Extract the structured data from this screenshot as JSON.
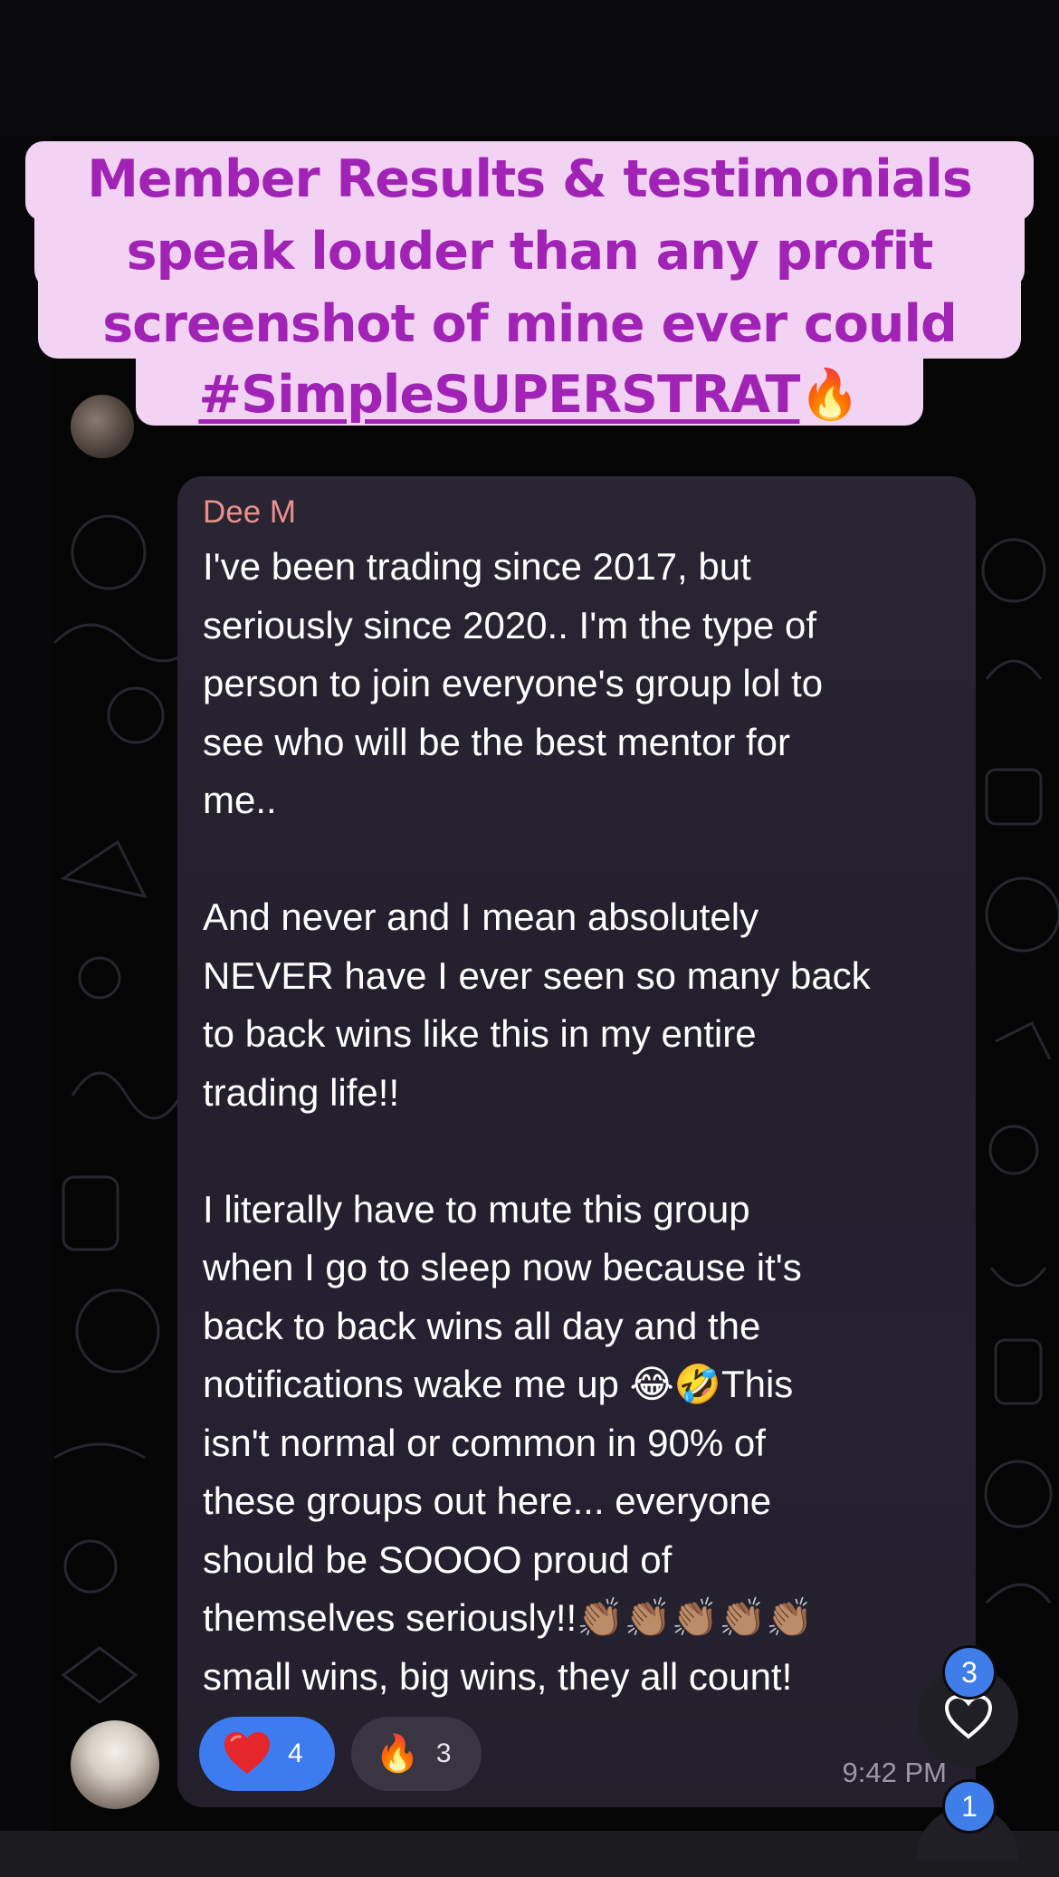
{
  "caption": {
    "lines": [
      "Member Results & testimonials",
      "speak louder than any profit",
      "screenshot of mine ever could",
      "#SimpleSUPERSTRAT"
    ],
    "color": "#a123b5",
    "background": "#f2d3f4"
  },
  "message": {
    "sender": "Dee M",
    "lines": [
      "I've been trading since 2017, but",
      "seriously since 2020.. I'm the type of",
      "person to join everyone's group lol to",
      "see who will be the best mentor for",
      "me..",
      "",
      "And never and I mean absolutely",
      "NEVER have I ever seen so many back",
      "to back wins like this in my entire",
      "trading life!!",
      "",
      "I literally have to mute this group",
      "when I go to sleep now because it's",
      "back to back wins all day and the",
      "notifications wake me up 😂🤣This",
      "isn't normal or common in 90% of",
      "these groups out here... everyone",
      "should be SOOOO proud of",
      "themselves seriously!!👏🏽👏🏽👏🏽👏🏽👏🏽",
      "small wins, big wins, they all count!"
    ],
    "time": "9:42 PM",
    "sender_color": "#e9908a"
  },
  "reactions": [
    {
      "icon": "heart-icon",
      "count": "4",
      "active": true
    },
    {
      "icon": "fire-icon",
      "count": "3",
      "active": false
    }
  ],
  "floating": {
    "unread_reactions": "3",
    "unread_messages": "1"
  }
}
